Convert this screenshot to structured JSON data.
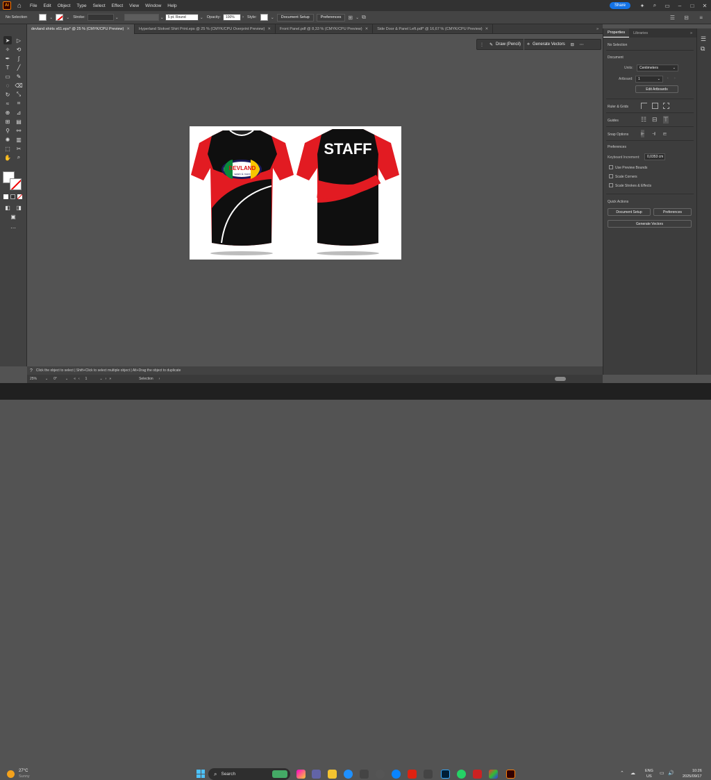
{
  "app": {
    "logo": "Ai",
    "accent": "#ff9a00"
  },
  "menu": [
    "File",
    "Edit",
    "Object",
    "Type",
    "Select",
    "Effect",
    "View",
    "Window",
    "Help"
  ],
  "menu_right": {
    "share": "Share"
  },
  "control": {
    "selection": "No Selection",
    "stroke_label": "Stroke:",
    "brush": "5 pt. Round",
    "opacity_label": "Opacity:",
    "opacity_value": "100%",
    "style_label": "Style:",
    "doc_setup": "Document Setup",
    "preferences": "Preferences"
  },
  "tabs": [
    {
      "label": "devland shirts x61.eps* @ 25 % (CMYK/CPU Preview)",
      "active": true
    },
    {
      "label": "Hyperland Stokvel Shirt Print.eps @ 25 % (CMYK/CPU Overprint Preview)",
      "active": false
    },
    {
      "label": "Front Panel.pdf @ 8,33 % (CMYK/CPU Preview)",
      "active": false
    },
    {
      "label": "Side Door & Panel Left.pdf* @ 16,67 % (CMYK/CPU Preview)",
      "active": false
    }
  ],
  "float_bar": {
    "draw": "Draw (Pencil)",
    "generate": "Generate Vectors"
  },
  "artwork": {
    "back_text": "STAFF",
    "logo_line1": "DEVLAND",
    "logo_line2": "wash & more"
  },
  "panel": {
    "tabs": [
      "Properties",
      "Libraries"
    ],
    "no_selection": "No Selection",
    "document": "Document",
    "units_label": "Units:",
    "units_value": "Centimeters",
    "artboard_label": "Artboard:",
    "artboard_value": "1",
    "edit_artboards": "Edit Artboards",
    "rulers": "Ruler & Grids",
    "guides": "Guides",
    "snap": "Snap Options",
    "preferences": "Preferences",
    "kbd_label": "Keyboard Increment:",
    "kbd_value": "0,0353 cm",
    "checks": [
      "Use Preview Bounds",
      "Scale Corners",
      "Scale Strokes & Effects"
    ],
    "quick": "Quick Actions",
    "doc_setup": "Document Setup",
    "prefs_btn": "Preferences",
    "gen_vectors": "Generate Vectors"
  },
  "status": "Click the object to select  |  Shift+Click to select multiple object  |  Alt+Drag the object to duplicate",
  "bottom": {
    "zoom": "25%",
    "angle": "0°",
    "artboard": "1",
    "mode": "Selection"
  },
  "taskbar": {
    "temp": "27°C",
    "weather": "Sunny",
    "search": "Search",
    "lang1": "ENG",
    "lang2": "US",
    "time": "10:26",
    "date": "2025/09/17"
  }
}
